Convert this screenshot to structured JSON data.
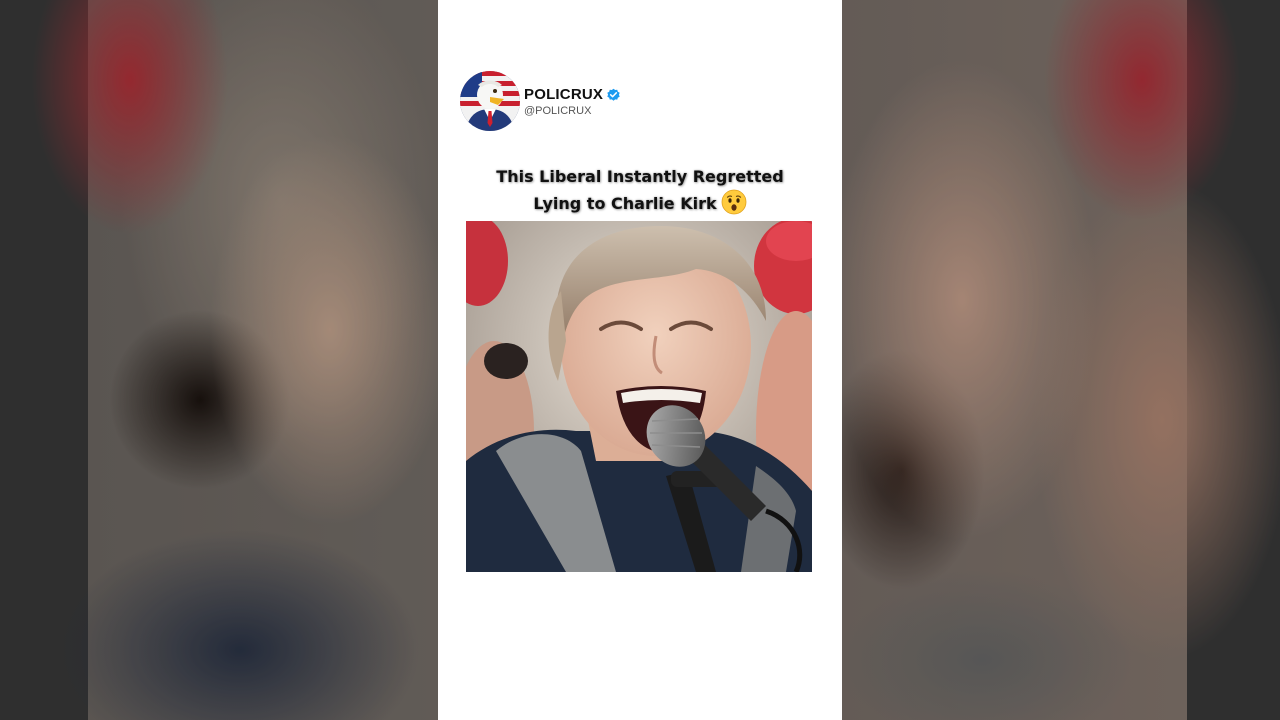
{
  "account": {
    "display_name": "POLICRUX",
    "handle": "@POLICRUX",
    "verified": true,
    "avatar_icon": "eagle-in-suit-avatar"
  },
  "post": {
    "title_line1": "This Liberal Instantly Regretted",
    "title_line2": "Lying to Charlie Kirk",
    "title_emoji": "astonished-face-emoji"
  },
  "media": {
    "description_icon": "video-frame-woman-at-microphone"
  },
  "colors": {
    "verified_badge": "#1d9bf0",
    "column_bg": "#ffffff",
    "title_text": "#111111"
  }
}
